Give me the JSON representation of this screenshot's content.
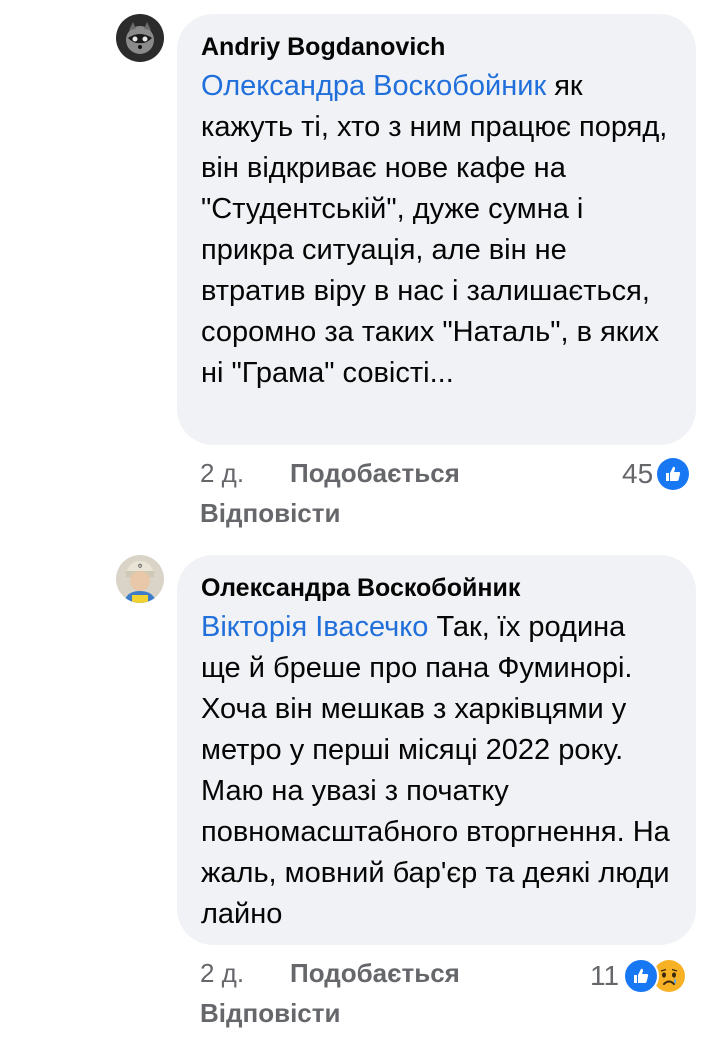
{
  "comments": [
    {
      "author": "Andriy Bogdanovich",
      "mention": "Олександра Воскобойник",
      "text": " як кажуть ті, хто з ним працює поряд, він відкриває нове кафе на \"Студентській\", дуже сумна і прикра ситуація, але він не втратив віру в нас і залишається, соромно за таких \"Наталь\", в яких ні \"Грама\" совісті...",
      "time": "2 д.",
      "like_label": "Подобається",
      "reply_label": "Відповісти",
      "reaction_count": "45",
      "reactions": [
        "like-icon"
      ]
    },
    {
      "author": "Олександра Воскобойник",
      "mention": "Вікторія Івасечко",
      "text": " Так, їх родина ще й бреше про пана Фуминорі. Хоча він мешкав з харківцями у метро у перші місяці 2022 року. Маю на увазі з початку повномасштабного вторгнення. На жаль, мовний бар'єр та деякі люди лайно",
      "time": "2 д.",
      "like_label": "Подобається",
      "reply_label": "Відповісти",
      "reaction_count": "11",
      "reactions": [
        "like-icon",
        "sad-icon"
      ]
    }
  ],
  "colors": {
    "bubble": "#f0f2f5",
    "mention": "#216fdb",
    "like_blue": "#1877f2",
    "sad_yellow": "#f7b125",
    "meta_gray": "#65676b"
  }
}
